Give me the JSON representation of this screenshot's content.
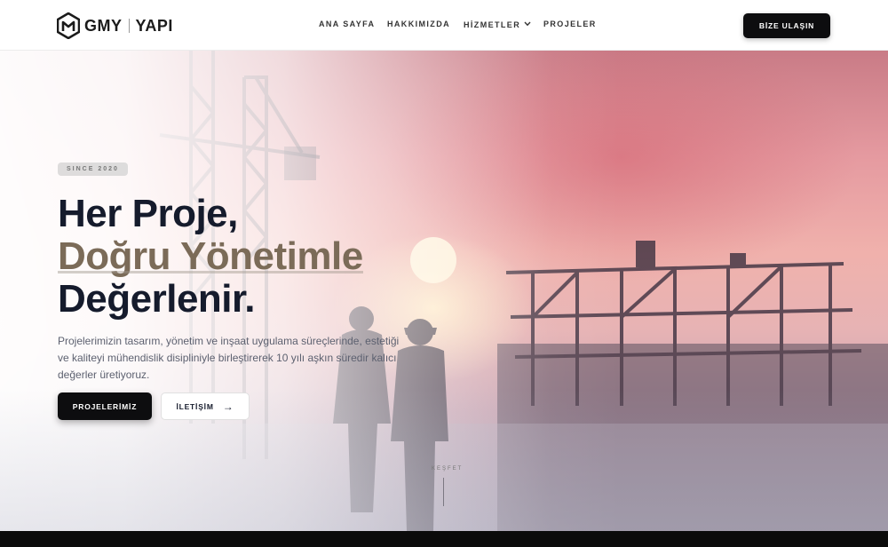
{
  "header": {
    "logo": {
      "brand": "GMY",
      "suffix": "YAPI"
    },
    "nav": [
      {
        "label": "ANA SAYFA"
      },
      {
        "label": "HAKKIMIZDA"
      },
      {
        "label": "HİZMETLER",
        "has_dropdown": true
      },
      {
        "label": "PROJELER"
      }
    ],
    "cta_label": "BİZE ULAŞIN"
  },
  "hero": {
    "badge": "SINCE 2020",
    "title_line1": "Her Proje,",
    "title_line2": "Doğru Yönetimle",
    "title_line3": "Değerlenir.",
    "description": "Projelerimizin tasarım, yönetim ve inşaat uygulama süreçlerinde, estetiği ve kaliteyi mühendislik disipliniyle birleştirerek 10 yılı aşkın süredir kalıcı değerler üretiyoruz.",
    "primary_button": "PROJELERİMİZ",
    "secondary_button": "İLETİŞİM",
    "secondary_icon": "arrow-right-icon",
    "scroll_label": "KEŞFET"
  },
  "colors": {
    "dark": "#0d0d0f",
    "title": "#151b2c",
    "accent": "#7b6b58"
  }
}
